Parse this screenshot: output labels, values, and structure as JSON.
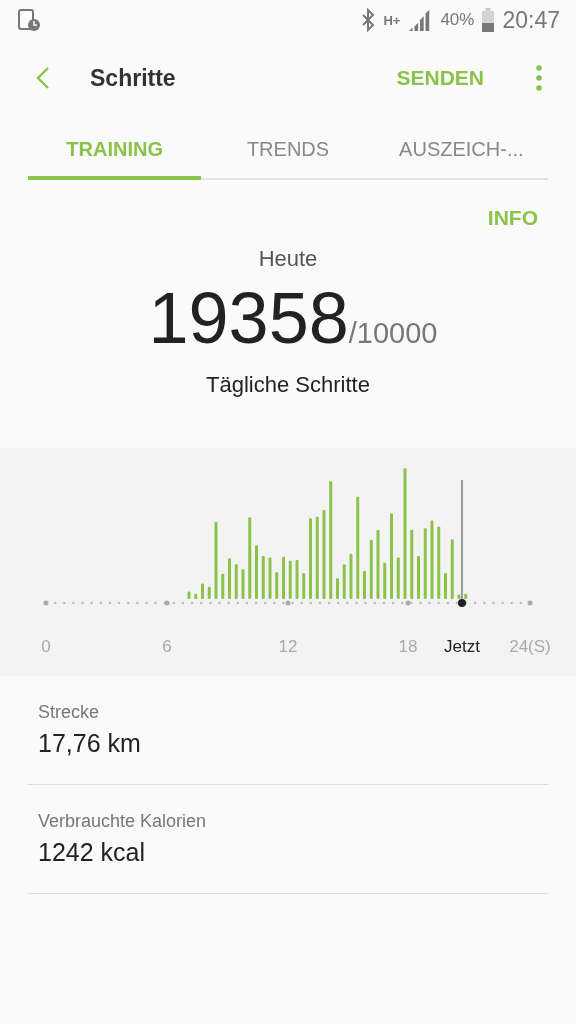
{
  "status_bar": {
    "network": "H+",
    "battery": "40%",
    "time": "20:47"
  },
  "header": {
    "title": "Schritte",
    "action": "SENDEN"
  },
  "tabs": [
    {
      "label": "TRAINING",
      "selected": true
    },
    {
      "label": "TRENDS",
      "selected": false
    },
    {
      "label": "AUSZEICH-...",
      "selected": false
    }
  ],
  "info_link": "INFO",
  "summary": {
    "period": "Heute",
    "steps": "19358",
    "goal": "/10000",
    "caption": "Tägliche Schritte"
  },
  "chart": {
    "axis_labels": [
      {
        "label": "0",
        "kind": "tick"
      },
      {
        "label": "6",
        "kind": "tick"
      },
      {
        "label": "12",
        "kind": "tick"
      },
      {
        "label": "18",
        "kind": "tick"
      },
      {
        "label": "Jetzt",
        "kind": "now"
      },
      {
        "label": "24(S)",
        "kind": "tick"
      }
    ]
  },
  "stats": [
    {
      "label": "Strecke",
      "value": "17,76 km"
    },
    {
      "label": "Verbrauchte Kalorien",
      "value": "1242 kcal"
    }
  ]
}
